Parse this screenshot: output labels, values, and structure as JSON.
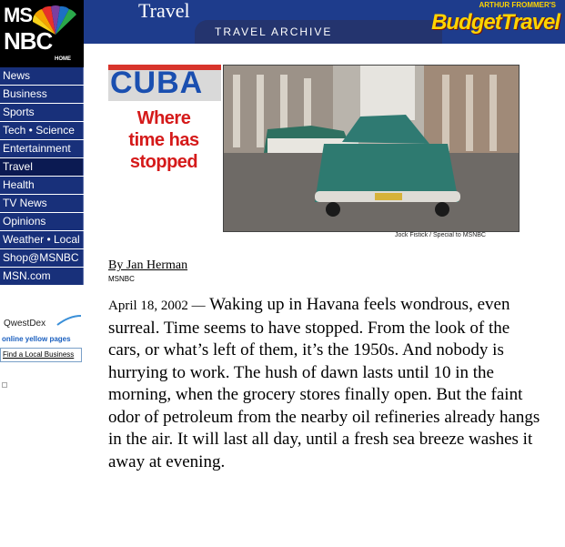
{
  "logo": {
    "line1": "MS",
    "line2": "NBC",
    "home": "HOME"
  },
  "header": {
    "section": "Travel",
    "archive": "TRAVEL ARCHIVE",
    "partner_small": "ARTHUR FROMMER'S",
    "partner_big": "BudgetTravel",
    "colors": {
      "header_bg": "#1e3c8c",
      "partner_text": "#ffd400"
    }
  },
  "nav": [
    "News",
    "Business",
    "Sports",
    "Tech • Science",
    "Entertainment",
    "Travel",
    "Health",
    "TV News",
    "Opinions",
    "Weather • Local",
    "Shop@MSNBC",
    "MSN.com"
  ],
  "nav_active": "Travel",
  "ad": {
    "brand": "QwestDex",
    "tagline": "online yellow pages",
    "link": "Find a Local Business"
  },
  "feature": {
    "title": "CUBA",
    "subtitle_lines": [
      "Where",
      "time has",
      "stopped"
    ],
    "photo_credit": "Jock Fistick / Special to MSNBC"
  },
  "article": {
    "byline": "By Jan Herman",
    "source": "MSNBC",
    "date": "April 18, 2002 —",
    "body": "Waking up in Havana feels wondrous, even surreal. Time seems to have stopped. From the look of the cars, or what’s left of them, it’s the 1950s. And nobody is hurrying to work. The hush of dawn lasts until 10 in the morning, when the grocery stores finally open. But the faint odor of petroleum from the nearby oil refineries already hangs in the air. It will last all day, until a fresh sea breeze washes it away at evening."
  }
}
